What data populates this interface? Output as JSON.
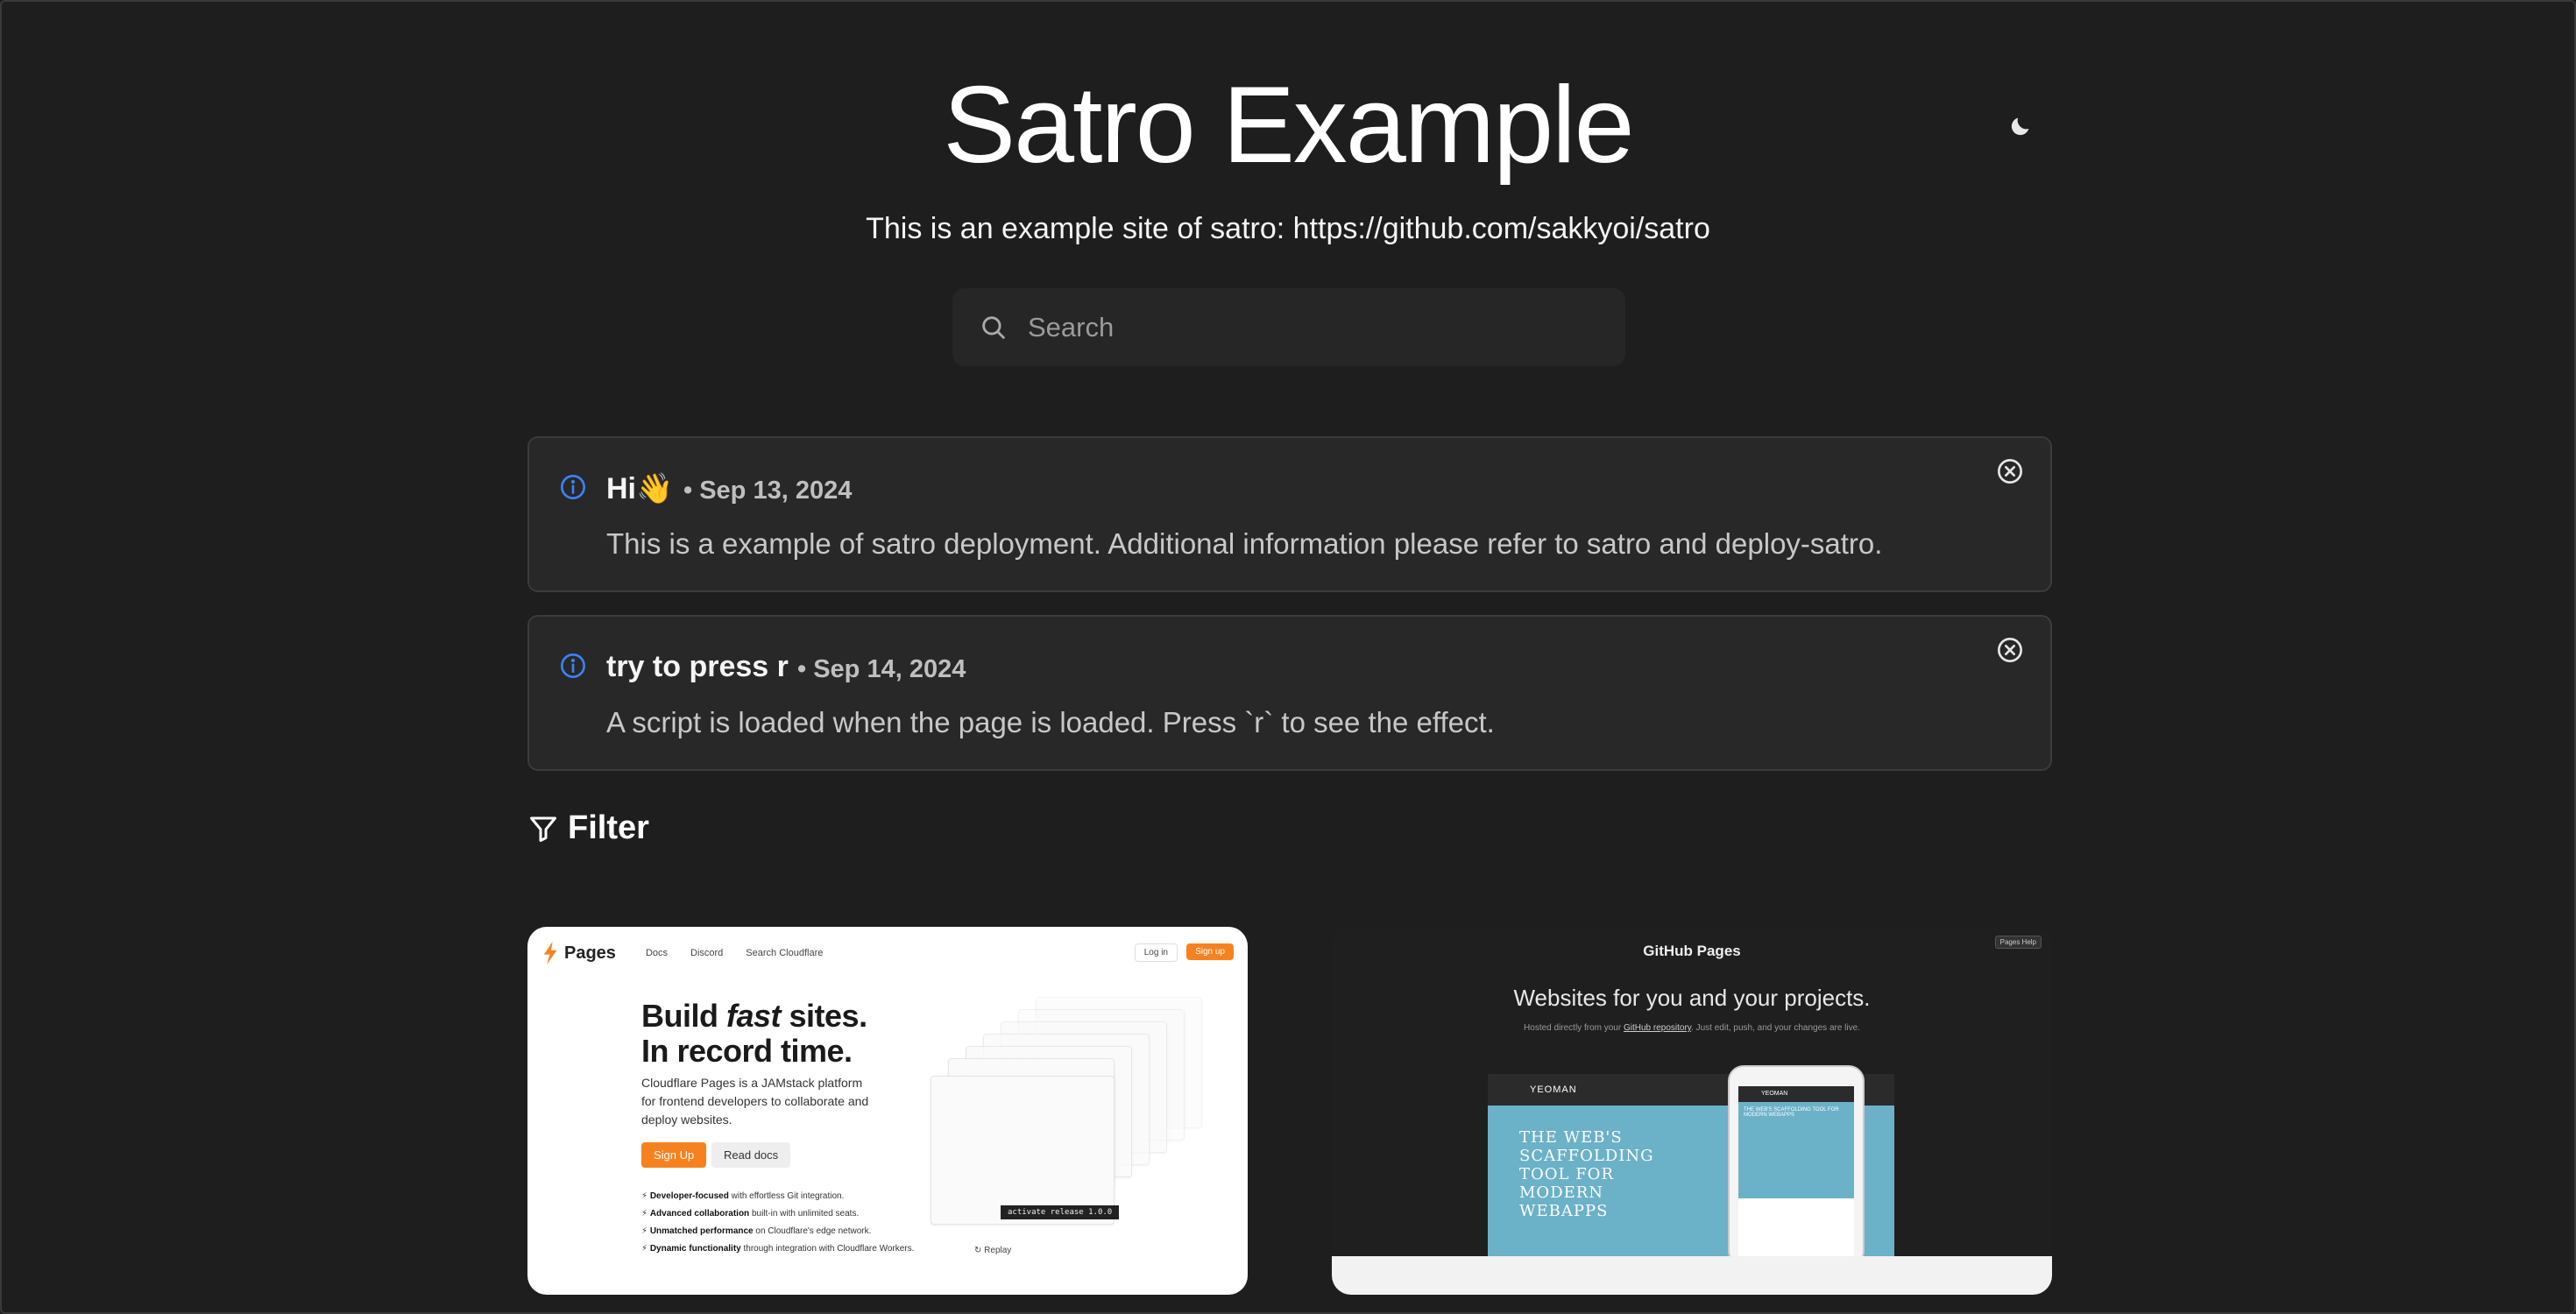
{
  "header": {
    "title": "Satro Example",
    "subtitle": "This is an example site of satro: https://github.com/sakkyoi/satro",
    "theme_toggle_icon": "moon-icon"
  },
  "search": {
    "placeholder": "Search",
    "value": ""
  },
  "notices": [
    {
      "title": "Hi👋",
      "date": "• Sep 13, 2024",
      "body": "This is a example of satro deployment. Additional information please refer to satro and deploy-satro."
    },
    {
      "title": "try to press r",
      "date": "• Sep 14, 2024",
      "body": "A script is loaded when the page is loaded. Press `r` to see the effect."
    }
  ],
  "filter": {
    "label": "Filter"
  },
  "cards": [
    {
      "name": "cloudflare-pages",
      "logo_small": "Cloudflare",
      "logo": "Pages",
      "nav": [
        "Docs",
        "Discord",
        "Search Cloudflare"
      ],
      "login": "Log in",
      "signup": "Sign up",
      "headline_1": "Build ",
      "headline_em": "fast",
      "headline_2": " sites.",
      "headline_3": "In record time.",
      "description": "Cloudflare Pages is a JAMstack platform for frontend developers to collaborate and deploy websites.",
      "primary_button": "Sign Up",
      "secondary_button": "Read docs",
      "features": [
        {
          "bold": "Developer-focused",
          "rest": " with effortless Git integration."
        },
        {
          "bold": "Advanced collaboration",
          "rest": " built-in with unlimited seats."
        },
        {
          "bold": "Unmatched performance",
          "rest": " on Cloudflare's edge network."
        },
        {
          "bold": "Dynamic functionality",
          "rest": " through integration with Cloudflare Workers."
        }
      ],
      "code": "activate release 1.0.0",
      "replay": "Replay"
    },
    {
      "name": "github-pages",
      "logo": "GitHub Pages",
      "help": "Pages Help",
      "headline": "Websites for you and your projects.",
      "sub_1": "Hosted directly from your ",
      "sub_link": "GitHub repository",
      "sub_2": ". Just edit, push, and your changes are live.",
      "yeoman_brand": "YEOMAN",
      "yeoman_text": "THE WEB'S SCAFFOLDING TOOL FOR MODERN WEBAPPS",
      "phone_brand": "YEOMAN"
    }
  ],
  "colors": {
    "background": "#1e1e1e",
    "card": "#282828",
    "info_accent": "#3b82f6",
    "cloudflare_orange": "#f6821f"
  }
}
